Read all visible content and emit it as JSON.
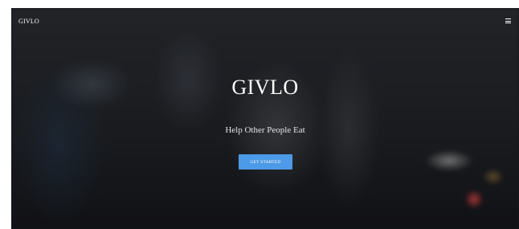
{
  "nav": {
    "brand": "GIVLO",
    "menu_icon": "hamburger-menu-icon"
  },
  "hero": {
    "title": "GIVLO",
    "subtitle": "Help Other People Eat",
    "cta_label": "GET STARTED"
  },
  "colors": {
    "cta_background": "#4c9ae8",
    "text": "#ffffff"
  }
}
